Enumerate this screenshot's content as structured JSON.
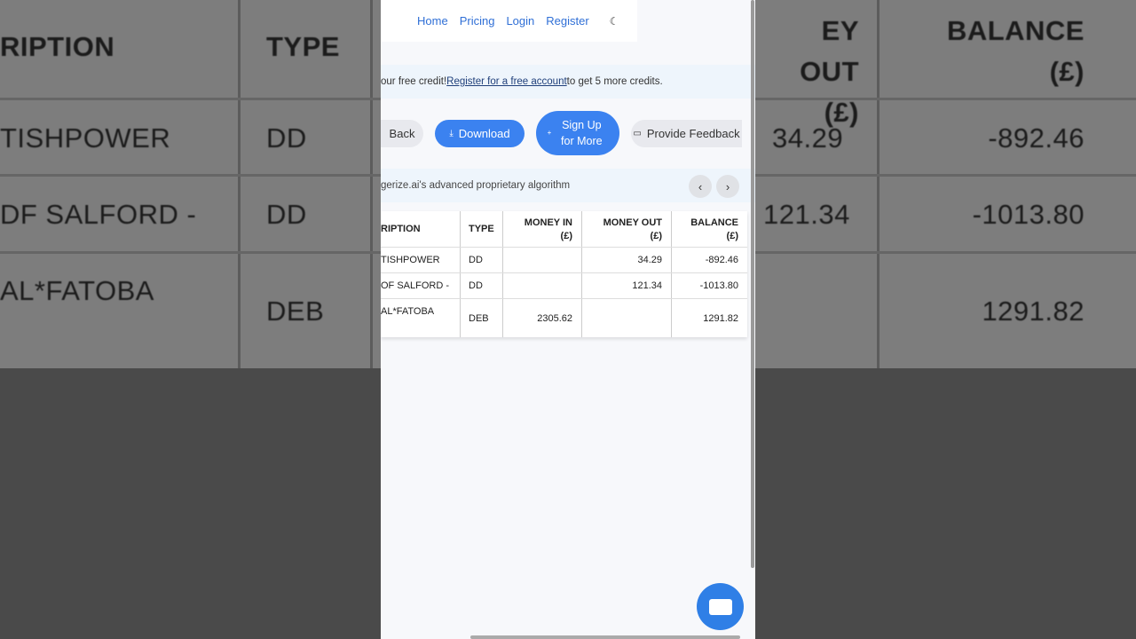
{
  "background": {
    "headers": [
      "RIPTION",
      "TYPE",
      "EY OUT (£)",
      "BALANCE (£)"
    ],
    "rows": [
      [
        "TISHPOWER",
        "DD",
        "34.29",
        "-892.46"
      ],
      [
        "DF SALFORD -",
        "DD",
        "121.34",
        "-1013.80"
      ],
      [
        "AL*FATOBA",
        "DEB",
        "",
        "1291.82"
      ]
    ]
  },
  "nav": {
    "items": [
      "Home",
      "Pricing",
      "Login",
      "Register"
    ]
  },
  "credit": {
    "prefix": "our free credit! ",
    "link": "Register for a free account",
    "suffix": " to get 5 more credits."
  },
  "buttons": {
    "back": "Back",
    "download": "Download",
    "signup": "Sign Up for More",
    "feedback": "Provide Feedback"
  },
  "algo": {
    "text": "gerize.ai's advanced proprietary algorithm"
  },
  "table": {
    "headers": [
      "RIPTION",
      "TYPE",
      "MONEY IN (£)",
      "MONEY OUT (£)",
      "BALANCE (£)"
    ],
    "rows": [
      [
        "TISHPOWER",
        "DD",
        "",
        "34.29",
        "-892.46"
      ],
      [
        "OF SALFORD -",
        "DD",
        "",
        "121.34",
        "-1013.80"
      ],
      [
        "AL*FATOBA",
        "DEB",
        "2305.62",
        "",
        "1291.82"
      ]
    ]
  },
  "colors": {
    "accent": "#3b82f0",
    "link": "#2f6fd6"
  }
}
